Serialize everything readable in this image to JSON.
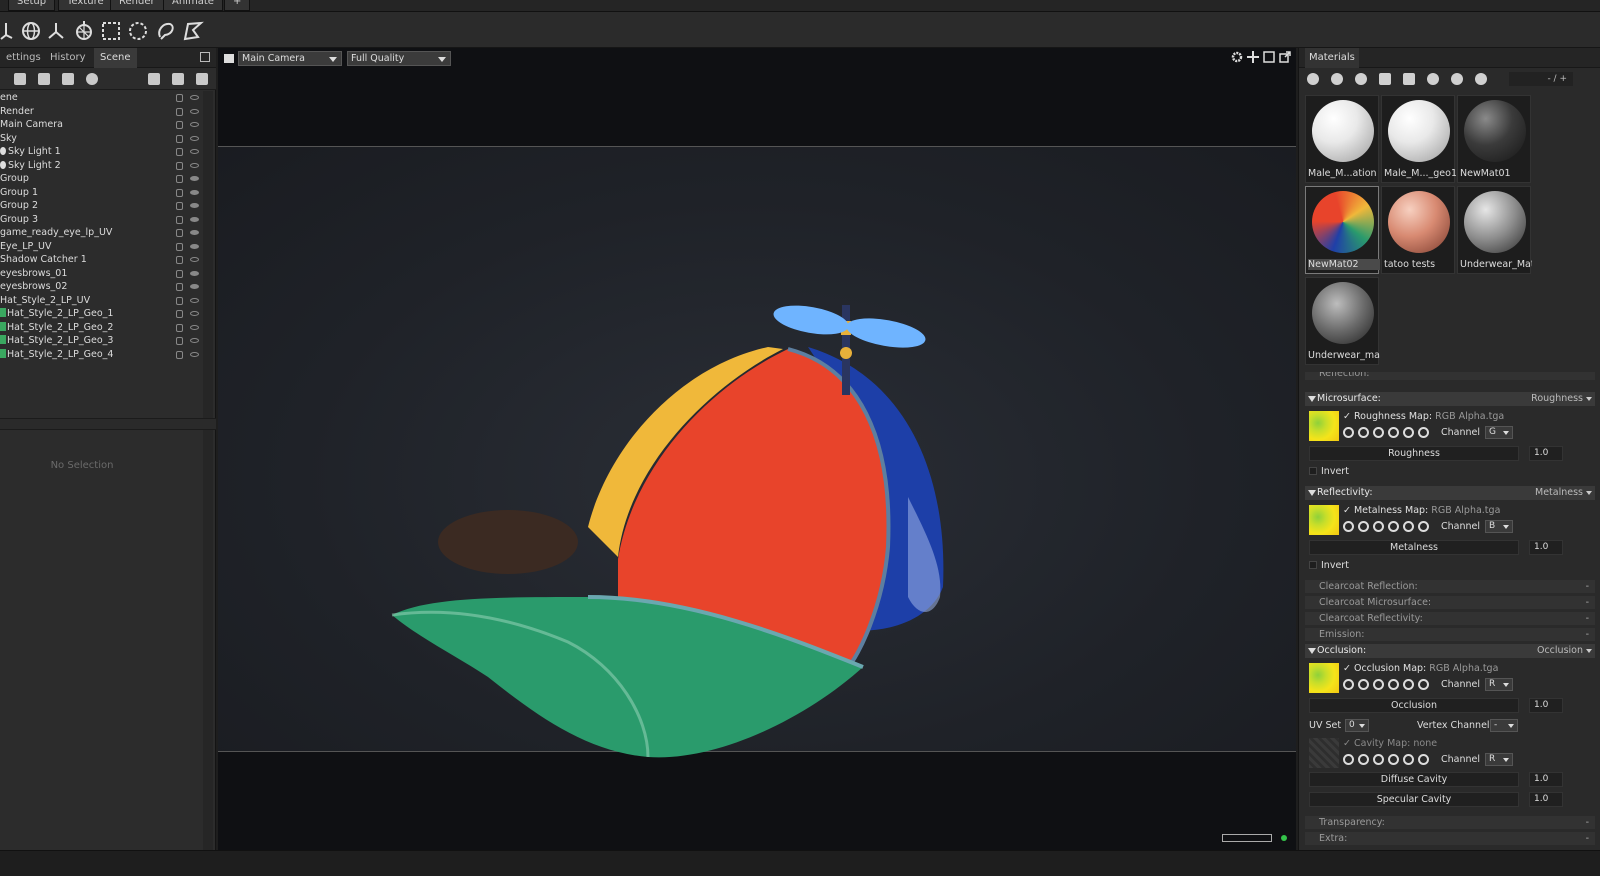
{
  "top_menu": {
    "tabs": [
      "Setup",
      "Texture",
      "Render",
      "Animate",
      "+"
    ]
  },
  "left_panel": {
    "tabs": [
      "ettings",
      "History",
      "Scene"
    ],
    "scene_items": [
      {
        "label": "ene",
        "icon": ""
      },
      {
        "label": "Render",
        "icon": ""
      },
      {
        "label": "Main Camera",
        "icon": ""
      },
      {
        "label": "Sky",
        "icon": ""
      },
      {
        "label": "Sky Light 1",
        "icon": "bulb"
      },
      {
        "label": "Sky Light 2",
        "icon": "bulb"
      },
      {
        "label": "Group",
        "icon": ""
      },
      {
        "label": "Group 1",
        "icon": ""
      },
      {
        "label": "Group 2",
        "icon": ""
      },
      {
        "label": "Group 3",
        "icon": ""
      },
      {
        "label": "game_ready_eye_lp_UV",
        "icon": ""
      },
      {
        "label": "Eye_LP_UV",
        "icon": ""
      },
      {
        "label": "Shadow Catcher 1",
        "icon": ""
      },
      {
        "label": "eyesbrows_01",
        "icon": ""
      },
      {
        "label": "eyesbrows_02",
        "icon": ""
      },
      {
        "label": "Hat_Style_2_LP_UV",
        "icon": ""
      },
      {
        "label": "Hat_Style_2_LP_Geo_1",
        "icon": "mesh"
      },
      {
        "label": "Hat_Style_2_LP_Geo_2",
        "icon": "mesh"
      },
      {
        "label": "Hat_Style_2_LP_Geo_3",
        "icon": "mesh"
      },
      {
        "label": "Hat_Style_2_LP_Geo_4",
        "icon": "mesh"
      }
    ],
    "no_selection": "No Selection"
  },
  "viewport": {
    "camera": "Main Camera",
    "quality": "Full Quality"
  },
  "materials": {
    "title": "Materials",
    "count": "- / +",
    "items": [
      {
        "name": "Male_M...ation",
        "ball": "white"
      },
      {
        "name": "Male_M..._geo1",
        "ball": "white"
      },
      {
        "name": "NewMat01",
        "ball": "dark"
      },
      {
        "name": "NewMat02",
        "ball": "color",
        "selected": true
      },
      {
        "name": "tatoo tests",
        "ball": "skin"
      },
      {
        "name": "Underwear_Mat",
        "ball": "gray"
      },
      {
        "name": "Underwear_mat",
        "ball": "gray2"
      }
    ]
  },
  "properties": {
    "reflection_cut": "Reflection:",
    "microsurface": {
      "title": "Microsurface:",
      "mode": "Roughness",
      "map_label": "Roughness Map:",
      "map_file": "RGB Alpha.tga",
      "channel_label": "Channel",
      "channel": "G",
      "slider_label": "Roughness",
      "slider_value": "1.0",
      "invert": "Invert"
    },
    "reflectivity": {
      "title": "Reflectivity:",
      "mode": "Metalness",
      "map_label": "Metalness Map:",
      "map_file": "RGB Alpha.tga",
      "channel_label": "Channel",
      "channel": "B",
      "slider_label": "Metalness",
      "slider_value": "1.0",
      "invert": "Invert"
    },
    "collapsed": [
      {
        "label": "Clearcoat Reflection:",
        "value": "-"
      },
      {
        "label": "Clearcoat Microsurface:",
        "value": "-"
      },
      {
        "label": "Clearcoat Reflectivity:",
        "value": "-"
      },
      {
        "label": "Emission:",
        "value": "-"
      }
    ],
    "occlusion": {
      "title": "Occlusion:",
      "mode": "Occlusion",
      "map_label": "Occlusion Map:",
      "map_file": "RGB Alpha.tga",
      "channel_label": "Channel",
      "channel": "R",
      "slider_label": "Occlusion",
      "slider_value": "1.0",
      "uv_set_label": "UV Set",
      "uv_set": "0",
      "vertex_channel_label": "Vertex Channel",
      "vertex_channel": "-",
      "cavity_label": "Cavity Map:",
      "cavity_file": "none",
      "cavity_channel": "R",
      "diffuse_cavity": "Diffuse Cavity",
      "diffuse_cavity_value": "1.0",
      "specular_cavity": "Specular Cavity",
      "specular_cavity_value": "1.0"
    },
    "collapsed_bottom": [
      {
        "label": "Transparency:",
        "value": "-"
      },
      {
        "label": "Extra:",
        "value": "-"
      }
    ]
  },
  "colors": {
    "hat_red": "#e8442b",
    "hat_yellow": "#f0b83a",
    "hat_blue": "#1d3fa8",
    "hat_green": "#2a9b6c",
    "propeller_blue": "#6fb4ff"
  }
}
